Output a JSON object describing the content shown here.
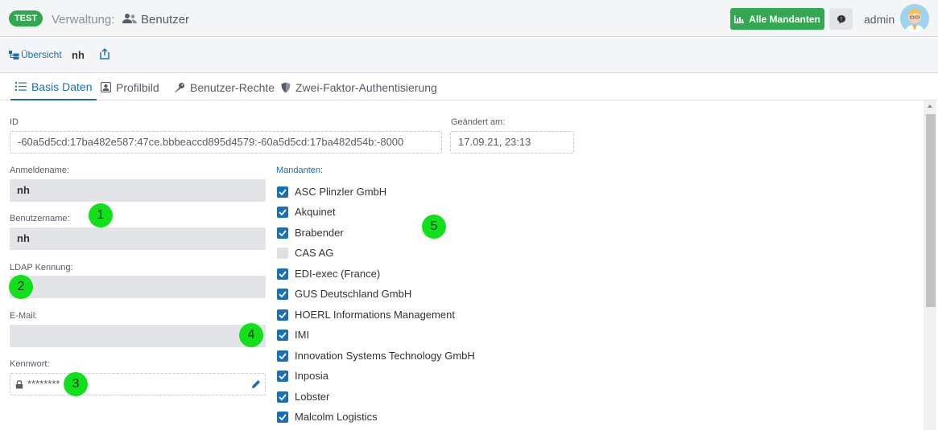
{
  "header": {
    "env_badge": "TEST",
    "section_label": "Verwaltung:",
    "page_title": "Benutzer",
    "all_clients_button": "Alle Mandanten",
    "username": "admin"
  },
  "toolbar": {
    "overview_label": "Übersicht",
    "record_name": "nh"
  },
  "tabs": [
    {
      "label": "Basis Daten",
      "active": true
    },
    {
      "label": "Profilbild"
    },
    {
      "label": "Benutzer-Rechte"
    },
    {
      "label": "Zwei-Faktor-Authentisierung"
    }
  ],
  "form": {
    "id_label": "ID",
    "id_value": "-60a5d5cd:17ba482e587:47ce.bbbeaccd895d4579:-60a5d5cd:17ba482d54b:-8000",
    "changed_label": "Geändert am:",
    "changed_value": "17.09.21, 23:13",
    "login_label": "Anmeldename:",
    "login_value": "nh",
    "username_label": "Benutzername:",
    "username_value": "nh",
    "ldap_label": "LDAP Kennung:",
    "ldap_value": "",
    "email_label": "E-Mail:",
    "email_value": "",
    "password_label": "Kennwort:",
    "password_value": "********"
  },
  "clients": {
    "label": "Mandanten:",
    "items": [
      {
        "name": "ASC Plinzler GmbH",
        "checked": true
      },
      {
        "name": "Akquinet",
        "checked": true
      },
      {
        "name": "Brabender",
        "checked": true
      },
      {
        "name": "CAS AG",
        "checked": false
      },
      {
        "name": "EDI-exec (France)",
        "checked": true
      },
      {
        "name": "GUS Deutschland GmbH",
        "checked": true
      },
      {
        "name": "HOERL Informations Management",
        "checked": true
      },
      {
        "name": "IMI",
        "checked": true
      },
      {
        "name": "Innovation Systems Technology GmbH",
        "checked": true
      },
      {
        "name": "Inposia",
        "checked": true
      },
      {
        "name": "Lobster",
        "checked": true
      },
      {
        "name": "Malcolm Logistics",
        "checked": true
      }
    ]
  },
  "markers": [
    "1",
    "2",
    "3",
    "4",
    "5"
  ],
  "colors": {
    "accent": "#1a6fb5",
    "success": "#33a852",
    "marker": "#11e01a"
  }
}
